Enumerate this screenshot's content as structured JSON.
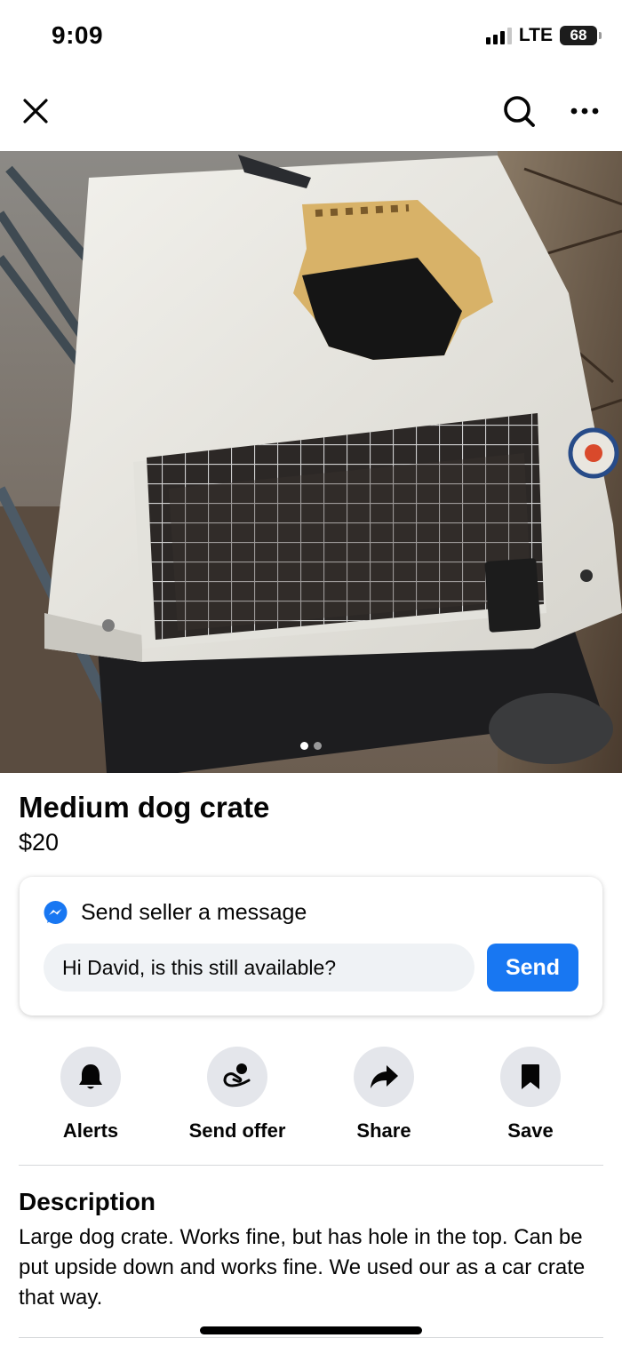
{
  "status_bar": {
    "time": "9:09",
    "network": "LTE",
    "battery": "68"
  },
  "nav": {
    "close_icon": "close-icon",
    "search_icon": "search-icon",
    "more_icon": "more-options-icon"
  },
  "photo": {
    "subject": "dog crate with hole in the top",
    "page_count": 2,
    "current_page": 1
  },
  "listing": {
    "title": "Medium dog crate",
    "price": "$20"
  },
  "message": {
    "heading": "Send seller a message",
    "input_value": "Hi David, is this still available?",
    "send_label": "Send",
    "messenger_icon": "messenger-icon"
  },
  "actions": [
    {
      "label": "Alerts",
      "icon": "bell-icon"
    },
    {
      "label": "Send offer",
      "icon": "offer-icon"
    },
    {
      "label": "Share",
      "icon": "share-icon"
    },
    {
      "label": "Save",
      "icon": "bookmark-icon"
    }
  ],
  "description": {
    "heading": "Description",
    "body": "Large dog crate. Works fine, but has hole in the top. Can be put upside down and works fine. We used our as a car crate that way."
  },
  "colors": {
    "accent": "#1877f2",
    "action_circle": "#e4e6eb",
    "input_bg": "#eff2f5"
  }
}
